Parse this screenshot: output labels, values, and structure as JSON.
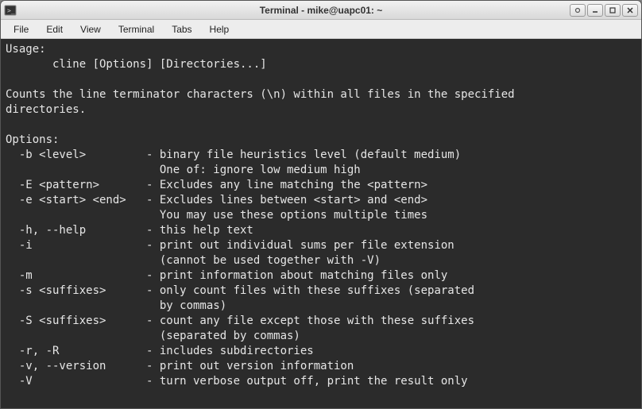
{
  "window": {
    "title": "Terminal - mike@uapc01: ~"
  },
  "menubar": {
    "items": [
      "File",
      "Edit",
      "View",
      "Terminal",
      "Tabs",
      "Help"
    ]
  },
  "terminal": {
    "lines": [
      "Usage:",
      "       cline [Options] [Directories...]",
      "",
      "Counts the line terminator characters (\\n) within all files in the specified",
      "directories.",
      "",
      "Options:",
      "  -b <level>         - binary file heuristics level (default medium)",
      "                       One of: ignore low medium high",
      "  -E <pattern>       - Excludes any line matching the <pattern>",
      "  -e <start> <end>   - Excludes lines between <start> and <end>",
      "                       You may use these options multiple times",
      "  -h, --help         - this help text",
      "  -i                 - print out individual sums per file extension",
      "                       (cannot be used together with -V)",
      "  -m                 - print information about matching files only",
      "  -s <suffixes>      - only count files with these suffixes (separated",
      "                       by commas)",
      "  -S <suffixes>      - count any file except those with these suffixes",
      "                       (separated by commas)",
      "  -r, -R             - includes subdirectories",
      "  -v, --version      - print out version information",
      "  -V                 - turn verbose output off, print the result only"
    ]
  }
}
